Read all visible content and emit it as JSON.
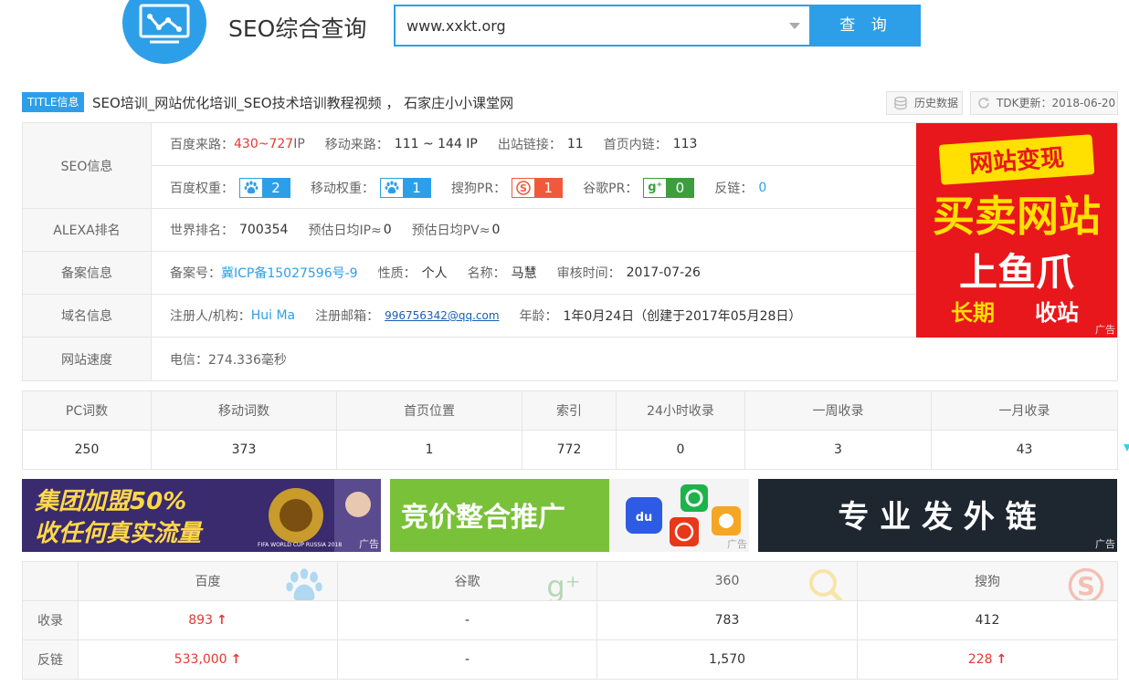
{
  "header": {
    "site_name": "SEO综合查询",
    "search_value": "www.xxkt.org",
    "search_button": "查 询"
  },
  "title_row": {
    "tag": "TITLE信息",
    "title": "SEO培训_网站优化培训_SEO技术培训教程视频 ， 石家庄小小课堂网",
    "history_btn": "历史数据",
    "tdk_btn": "TDK更新：2018-06-20"
  },
  "seo_info": {
    "label": "SEO信息",
    "baidu_traffic_label": "百度来路：",
    "baidu_traffic_low": "430",
    "baidu_traffic_sep": " ~ ",
    "baidu_traffic_high": "727",
    "baidu_traffic_unit": " IP",
    "mobile_traffic_label": "移动来路：",
    "mobile_traffic_value": "111 ~ 144 IP",
    "outbound_label": "出站链接：",
    "outbound_value": "11",
    "home_inlinks_label": "首页内链：",
    "home_inlinks_value": "113",
    "baidu_weight_label": "百度权重：",
    "baidu_weight_value": "2",
    "mobile_weight_label": "移动权重：",
    "mobile_weight_value": "1",
    "sogou_pr_label": "搜狗PR：",
    "sogou_pr_value": "1",
    "google_pr_label": "谷歌PR：",
    "google_pr_value": "0",
    "backlinks_label": "反链：",
    "backlinks_value": "0"
  },
  "alexa": {
    "label": "ALEXA排名",
    "world_rank_label": "世界排名：",
    "world_rank_value": "700354",
    "daily_ip_label": "预估日均IP≈",
    "daily_ip_value": "0",
    "daily_pv_label": "预估日均PV≈",
    "daily_pv_value": "0"
  },
  "icp": {
    "label": "备案信息",
    "number_label": "备案号：",
    "number_value": "冀ICP备15027596号-9",
    "nature_label": "性质：",
    "nature_value": "个人",
    "name_label": "名称：",
    "name_value": "马慧",
    "audit_label": "审核时间：",
    "audit_value": "2017-07-26"
  },
  "domain": {
    "label": "域名信息",
    "registrant_label": "注册人/机构：",
    "registrant_value": "Hui Ma",
    "email_label": "注册邮箱：",
    "email_value": "996756342@qq.com",
    "age_label": "年龄：",
    "age_value": "1年0月24日（创建于2017年05月28日）"
  },
  "speed": {
    "label": "网站速度",
    "value": "电信：274.336毫秒"
  },
  "side_ad": {
    "line1": "网站变现",
    "line2": "买卖网站",
    "line3": "上鱼爪",
    "line4a": "长期",
    "line4b": "收站",
    "tag": "广告",
    "colors": {
      "bg": "#e8171b",
      "accent": "#ffe000"
    }
  },
  "stats": {
    "headers": [
      "PC词数",
      "移动词数",
      "首页位置",
      "索引",
      "24小时收录",
      "一周收录",
      "一月收录"
    ],
    "values": [
      "250",
      "373",
      "1",
      "772",
      "0",
      "3",
      "43"
    ]
  },
  "banners": [
    {
      "line1": "集团加盟50%",
      "line2": "收任何真实流量",
      "badge": "FIFA WORLD CUP RUSSIA 2018",
      "tag": "广告"
    },
    {
      "text": "竞价整合推广",
      "baidu_icon": "du",
      "tag": "广告"
    },
    {
      "text": "专 业 发 外 链",
      "tag": "广告"
    }
  ],
  "engines": {
    "headers": [
      "百度",
      "谷歌",
      "360",
      "搜狗"
    ],
    "rows": [
      {
        "label": "收录",
        "values": [
          "893",
          "-",
          "783",
          "412"
        ]
      },
      {
        "label": "反链",
        "values": [
          "533,000",
          "-",
          "1,570",
          "228"
        ]
      }
    ]
  }
}
